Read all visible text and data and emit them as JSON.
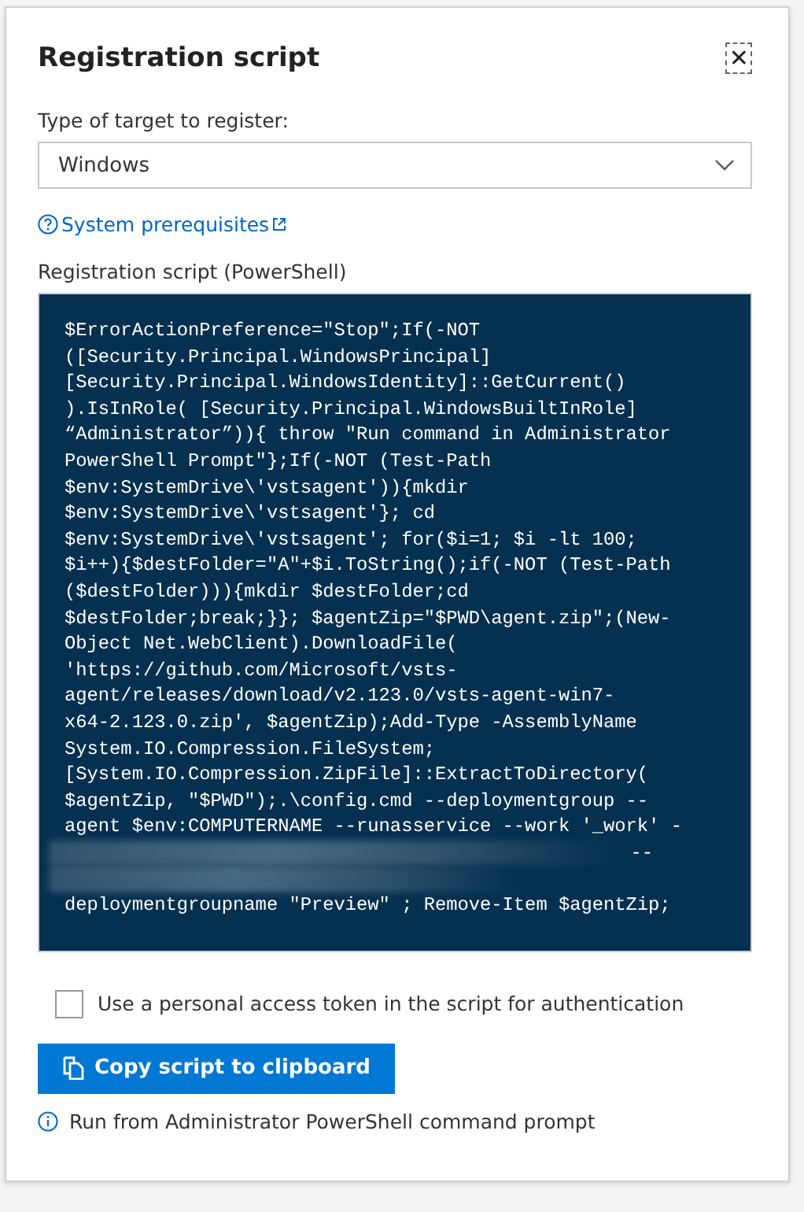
{
  "dialog": {
    "title": "Registration script",
    "close": "✕"
  },
  "target_type": {
    "label": "Type of target to register:",
    "value": "Windows"
  },
  "prerequisites_link": {
    "text": "System prerequisites"
  },
  "script": {
    "label": "Registration script (PowerShell)",
    "lines": [
      {
        "kind": "text",
        "text": "$ErrorActionPreference=\"Stop\";If(-NOT"
      },
      {
        "kind": "text",
        "text": "([Security.Principal.WindowsPrincipal]"
      },
      {
        "kind": "text",
        "text": "[Security.Principal.WindowsIdentity]::GetCurrent()"
      },
      {
        "kind": "text",
        "text": ").IsInRole( [Security.Principal.WindowsBuiltInRole]"
      },
      {
        "kind": "text",
        "text": "“Administrator”)){ throw \"Run command in Administrator"
      },
      {
        "kind": "text",
        "text": "PowerShell Prompt\"};If(-NOT (Test-Path"
      },
      {
        "kind": "text",
        "text": "$env:SystemDrive\\'vstsagent')){mkdir"
      },
      {
        "kind": "text",
        "text": "$env:SystemDrive\\'vstsagent'}; cd"
      },
      {
        "kind": "text",
        "text": "$env:SystemDrive\\'vstsagent'; for($i=1; $i -lt 100;"
      },
      {
        "kind": "text",
        "text": "$i++){$destFolder=\"A\"+$i.ToString();if(-NOT (Test-Path"
      },
      {
        "kind": "text",
        "text": "($destFolder))){mkdir $destFolder;cd"
      },
      {
        "kind": "text",
        "text": "$destFolder;break;}}; $agentZip=\"$PWD\\agent.zip\";(New-"
      },
      {
        "kind": "text",
        "text": "Object Net.WebClient).DownloadFile("
      },
      {
        "kind": "text",
        "text": "'https://github.com/Microsoft/vsts-"
      },
      {
        "kind": "text",
        "text": "agent/releases/download/v2.123.0/vsts-agent-win7-"
      },
      {
        "kind": "text",
        "text": "x64-2.123.0.zip', $agentZip);Add-Type -AssemblyName"
      },
      {
        "kind": "text",
        "text": "System.IO.Compression.FileSystem;"
      },
      {
        "kind": "text",
        "text": "[System.IO.Compression.ZipFile]::ExtractToDirectory("
      },
      {
        "kind": "text",
        "text": "$agentZip, \"$PWD\");.\\config.cmd --deploymentgroup --"
      },
      {
        "kind": "text",
        "text": "agent $env:COMPUTERNAME --runasservice --work '_work' -"
      },
      {
        "kind": "blurred",
        "text": "--"
      },
      {
        "kind": "blurred"
      },
      {
        "kind": "text",
        "text": "deploymentgroupname \"Preview\" ; Remove-Item $agentZip;"
      }
    ]
  },
  "pat_option": {
    "label": "Use a personal access token in the script for authentication",
    "checked": false
  },
  "copy_button": {
    "label": "Copy script to clipboard"
  },
  "hint": {
    "text": "Run from Administrator PowerShell command prompt"
  }
}
